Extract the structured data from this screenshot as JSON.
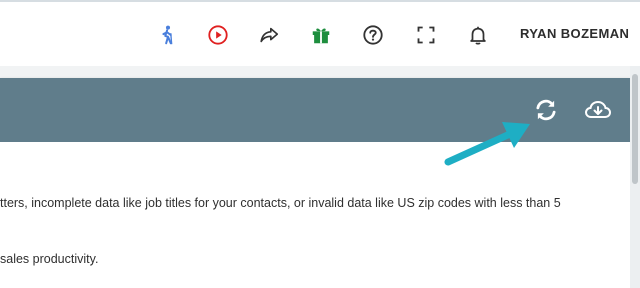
{
  "topbar": {
    "icons": {
      "walkthrough": "walking-person-icon",
      "video": "play-circle-icon",
      "share": "share-icon",
      "gift": "gift-icon",
      "help": "help-circle-icon",
      "fullscreen": "fullscreen-icon",
      "notifications": "bell-icon"
    },
    "user_name": "RYAN BOZEMAN"
  },
  "card": {
    "header_icons": {
      "refresh": "refresh-icon",
      "download": "cloud-download-icon"
    },
    "text_line_1": "tters, incomplete data like job titles for your contacts, or invalid data like US zip codes with less than 5",
    "text_line_2": "sales productivity."
  },
  "colors": {
    "header_bg": "#607d8b",
    "walkthrough_icon": "#4a7fdc",
    "video_icon": "#e02020",
    "gift_icon": "#1e8e3e",
    "arrow": "#1eaec4"
  }
}
